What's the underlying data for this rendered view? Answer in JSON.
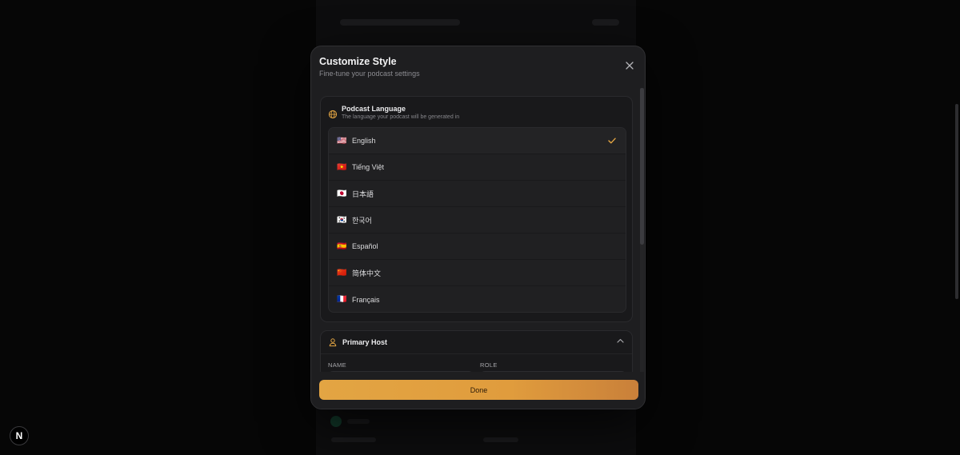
{
  "modal": {
    "title": "Customize Style",
    "subtitle": "Fine-tune your podcast settings"
  },
  "language_section": {
    "title": "Podcast Language",
    "description": "The language your podcast will be generated in",
    "selected": "English",
    "items": [
      {
        "flag": "🇺🇸",
        "label": "English",
        "selected": true
      },
      {
        "flag": "🇻🇳",
        "label": "Tiếng Việt",
        "selected": false
      },
      {
        "flag": "🇯🇵",
        "label": "日本語",
        "selected": false
      },
      {
        "flag": "🇰🇷",
        "label": "한국어",
        "selected": false
      },
      {
        "flag": "🇪🇸",
        "label": "Español",
        "selected": false
      },
      {
        "flag": "🇨🇳",
        "label": "简体中文",
        "selected": false
      },
      {
        "flag": "🇫🇷",
        "label": "Français",
        "selected": false
      }
    ]
  },
  "host_section": {
    "title": "Primary Host",
    "name_label": "NAME",
    "role_label": "ROLE"
  },
  "footer": {
    "done_label": "Done"
  },
  "badge": {
    "label": "N"
  },
  "colors": {
    "accent": "#e3a543",
    "background": "#060606",
    "modal_bg": "#1e1e20"
  },
  "icons": {
    "close": "close-icon",
    "globe": "globe-icon",
    "check": "check-icon",
    "user": "user-icon",
    "chevron": "chevron-up-icon"
  }
}
